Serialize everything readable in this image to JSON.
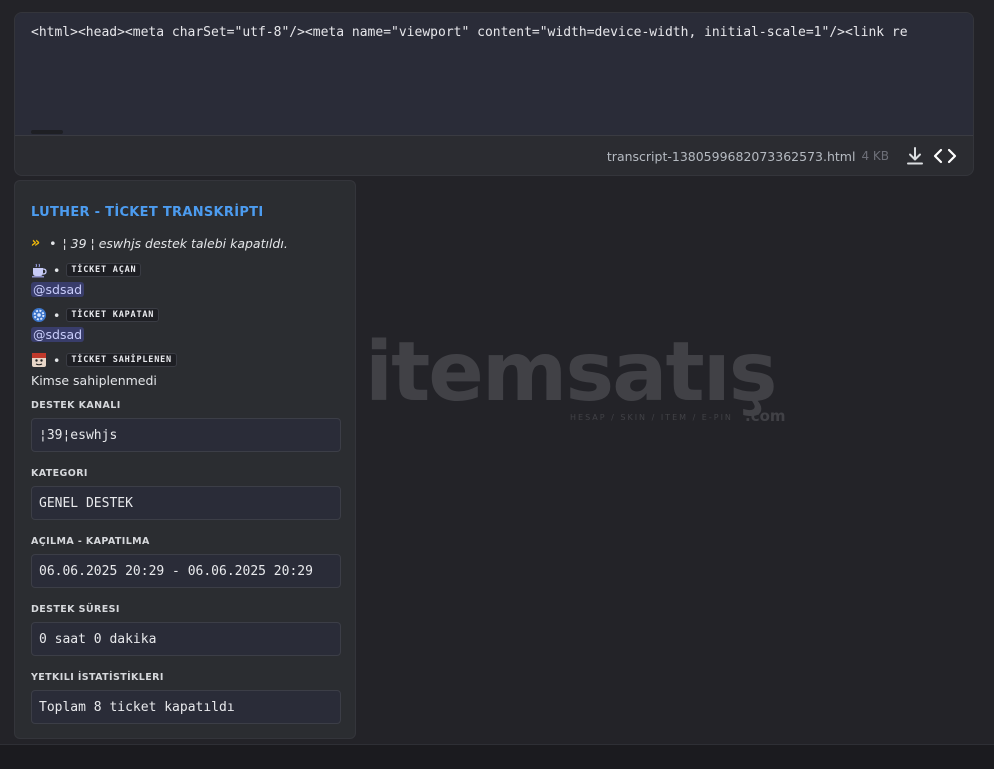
{
  "file": {
    "code_preview": "<html><head><meta charSet=\"utf-8\"/><meta name=\"viewport\" content=\"width=device-width, initial-scale=1\"/><link re",
    "name": "transcript-1380599682073362573.html",
    "size": "4 KB",
    "download_icon": "download-icon",
    "code_icon": "code-brackets-icon"
  },
  "embed": {
    "title": "LUTHER - TİCKET TRANSKRİPTI",
    "closed_line": {
      "prefix": "»",
      "separator": "•",
      "text": "¦ 39 ¦ eswhjs destek talebi kapatıldı."
    },
    "opener": {
      "badge": "TİCKET AÇAN",
      "user": "@sdsad",
      "icon": "coffee-icon"
    },
    "closer": {
      "badge": "TİCKET KAPATAN",
      "user": "@sdsad",
      "icon": "gear-icon"
    },
    "claimer": {
      "badge": "TİCKET SAHİPLENEN",
      "value": "Kimse sahiplenmedi",
      "icon": "avatar-icon"
    },
    "separator": "•",
    "fields": [
      {
        "name": "DESTEK KANALI",
        "value": "¦39¦eswhjs"
      },
      {
        "name": "KATEGORI",
        "value": "GENEL DESTEK"
      },
      {
        "name": "AÇILMA - KAPATILMA",
        "value": "06.06.2025 20:29 - 06.06.2025 20:29"
      },
      {
        "name": "DESTEK SÜRESI",
        "value": "0 saat 0 dakika"
      },
      {
        "name": "YETKILI İSTATİSTİKLERI",
        "value": "Toplam 8 ticket kapatıldı"
      }
    ]
  },
  "watermark": {
    "brand": "itemsatış",
    "tagline": "HESAP / SKIN / ITEM / E-PIN",
    "suffix": ".com"
  },
  "colors": {
    "title": "#4c9cf0",
    "mention_bg": "#3f4370",
    "accent_chevron": "#f0b90b"
  }
}
